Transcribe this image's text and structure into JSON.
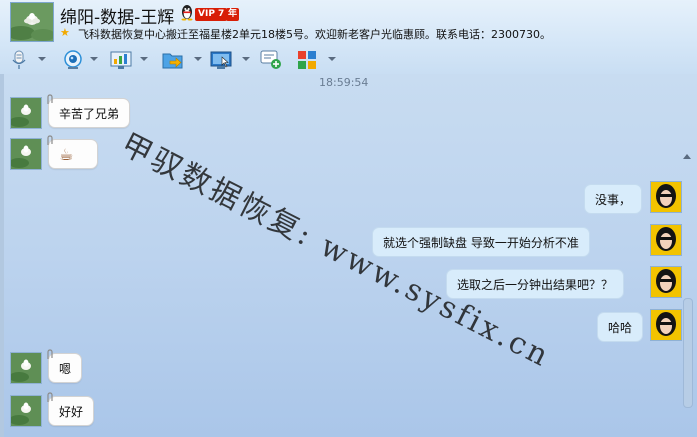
{
  "header": {
    "title": "绵阳-数据-王辉",
    "vip_label": "VIP 7",
    "year_label": "年",
    "signature": "飞科数据恢复中心搬迁至福星楼2单元18楼5号。欢迎新老客户光临惠顾。联系电话：2300730。"
  },
  "toolbar": {
    "tools": [
      {
        "icon": "microphone-icon"
      },
      {
        "icon": "webcam-icon"
      },
      {
        "icon": "screen-share-icon"
      },
      {
        "icon": "send-file-icon"
      },
      {
        "icon": "remote-desktop-icon"
      },
      {
        "icon": "create-discussion-icon"
      },
      {
        "icon": "apps-icon"
      }
    ]
  },
  "chat": {
    "timestamp": "18:59:54",
    "messages": [
      {
        "side": "left",
        "text": "辛苦了兄弟"
      },
      {
        "side": "left",
        "text": "☕"
      },
      {
        "side": "right",
        "text": "没事，"
      },
      {
        "side": "right",
        "text": "就选个强制缺盘 导致一开始分析不准"
      },
      {
        "side": "right",
        "text": "选取之后一分钟出结果吧？？"
      },
      {
        "side": "right",
        "text": "哈哈"
      },
      {
        "side": "left",
        "text": "嗯"
      },
      {
        "side": "left",
        "text": "好好"
      }
    ]
  },
  "watermark": "甲驭数据恢复: www.sysfix.cn",
  "colors": {
    "vip_red": "#d81e06",
    "right_bubble": "#d8ecfb",
    "left_bubble": "#fdfdfd"
  }
}
